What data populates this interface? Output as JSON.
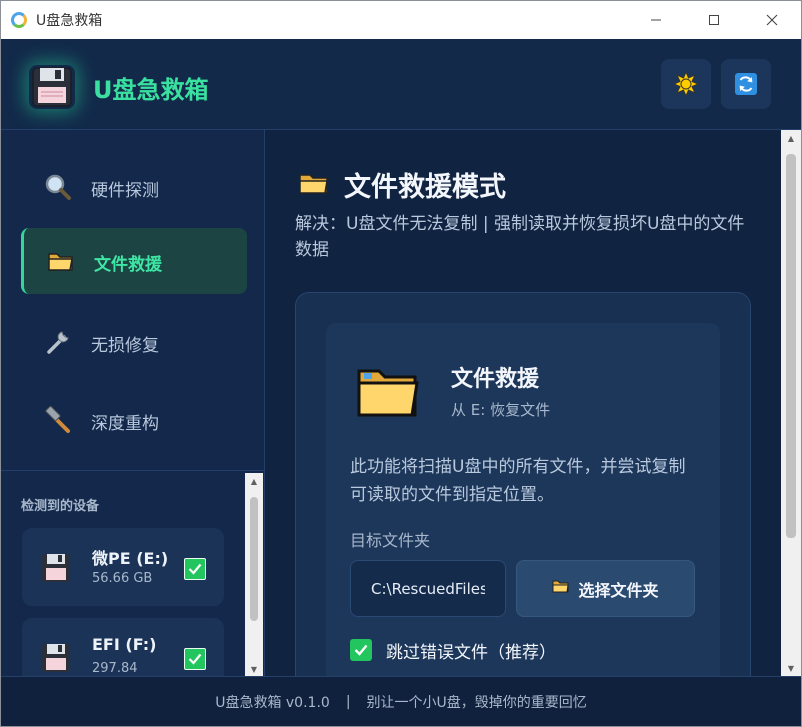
{
  "window": {
    "title": "U盘急救箱"
  },
  "header": {
    "app_name": "U盘急救箱",
    "theme_icon": "sun-icon",
    "refresh_icon": "refresh-icon"
  },
  "sidebar": {
    "items": [
      {
        "label": "硬件探测",
        "icon": "magnifier-icon",
        "active": false
      },
      {
        "label": "文件救援",
        "icon": "folder-icon",
        "active": true
      },
      {
        "label": "无损修复",
        "icon": "wrench-icon",
        "active": false
      },
      {
        "label": "深度重构",
        "icon": "hammer-icon",
        "active": false
      }
    ],
    "devices_title": "检测到的设备",
    "devices": [
      {
        "name": "微PE (E:)",
        "size": "56.66 GB",
        "checked": true
      },
      {
        "name": "EFI (F:)",
        "size": "297.84",
        "checked": true
      }
    ]
  },
  "main": {
    "title": "文件救援模式",
    "description": "解决：U盘文件无法复制 | 强制读取并恢复损坏U盘中的文件数据",
    "card": {
      "title": "文件救援",
      "subtitle": "从 E: 恢复文件",
      "description": "此功能将扫描U盘中的所有文件，并尝试复制可读取的文件到指定位置。",
      "target_label": "目标文件夹",
      "target_value": "C:\\RescuedFiles",
      "choose_label": "选择文件夹",
      "skip_label": "跳过错误文件（推荐）",
      "skip_checked": true
    }
  },
  "footer": {
    "version": "U盘急救箱 v0.1.0",
    "separator": "|",
    "slogan": "别让一个小U盘，毁掉你的重要回忆"
  },
  "colors": {
    "accent": "#39e0a0",
    "background": "#10233f",
    "check": "#22c55e"
  }
}
